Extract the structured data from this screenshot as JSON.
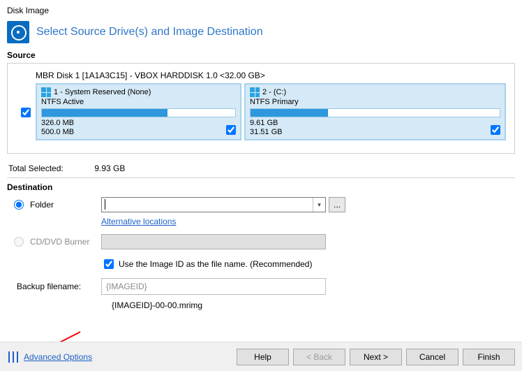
{
  "window_title": "Disk Image",
  "page_title": "Select Source Drive(s) and Image Destination",
  "source": {
    "label": "Source",
    "disk_label": "MBR Disk 1 [1A1A3C15] - VBOX HARDDISK 1.0  <32.00 GB>",
    "disk_checked": true,
    "partitions": [
      {
        "title": "1 - System Reserved (None)",
        "sub": "NTFS Active",
        "used": "326.0 MB",
        "total": "500.0 MB",
        "fill_pct": 65,
        "checked": true
      },
      {
        "title": "2 -  (C:)",
        "sub": "NTFS Primary",
        "used": "9.61 GB",
        "total": "31.51 GB",
        "fill_pct": 31,
        "checked": true
      }
    ]
  },
  "total_selected": {
    "label": "Total Selected:",
    "value": "9.93 GB"
  },
  "destination": {
    "label": "Destination",
    "folder_label": "Folder",
    "folder_value": "",
    "alt_locations": "Alternative locations",
    "cd_label": "CD/DVD Burner",
    "use_id_label": "Use the Image ID as the file name.  (Recommended)",
    "use_id_checked": true,
    "filename_label": "Backup filename:",
    "filename_value": "{IMAGEID}",
    "preview": "{IMAGEID}-00-00.mrimg"
  },
  "footer": {
    "advanced": "Advanced Options",
    "help": "Help",
    "back": "< Back",
    "next": "Next >",
    "cancel": "Cancel",
    "finish": "Finish"
  }
}
